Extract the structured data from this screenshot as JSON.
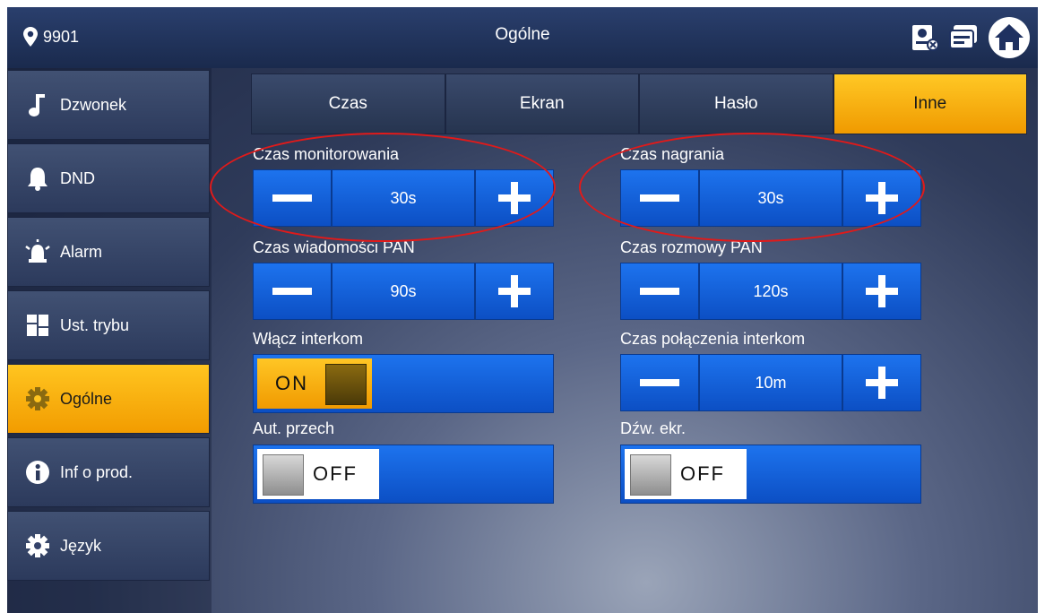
{
  "header": {
    "location": "9901",
    "title": "Ogólne",
    "icons": [
      "location-pin-icon",
      "monitor-camera-icon",
      "card-icon",
      "home-icon"
    ]
  },
  "sidebar": {
    "items": [
      {
        "label": "Dzwonek",
        "icon": "music-note-icon"
      },
      {
        "label": "DND",
        "icon": "bell-icon"
      },
      {
        "label": "Alarm",
        "icon": "alarm-siren-icon"
      },
      {
        "label": "Ust. trybu",
        "icon": "grid-mode-icon"
      },
      {
        "label": "Ogólne",
        "icon": "gear-icon",
        "active": true
      },
      {
        "label": "Inf o prod.",
        "icon": "info-icon"
      },
      {
        "label": "Język",
        "icon": "gear-icon"
      }
    ]
  },
  "tabs": [
    {
      "label": "Czas"
    },
    {
      "label": "Ekran"
    },
    {
      "label": "Hasło"
    },
    {
      "label": "Inne",
      "active": true
    }
  ],
  "settings": {
    "monitor_time": {
      "label": "Czas monitorowania",
      "value": "30s"
    },
    "record_time": {
      "label": "Czas nagrania",
      "value": "30s"
    },
    "vto_message_time": {
      "label": "Czas wiadomości PAN",
      "value": "90s"
    },
    "vto_talk_time": {
      "label": "Czas rozmowy PAN",
      "value": "120s"
    },
    "intercom_enable": {
      "label": "Włącz interkom",
      "state": "ON"
    },
    "intercom_call_time": {
      "label": "Czas połączenia interkom",
      "value": "10m"
    },
    "auto_snapshot": {
      "label": "Aut. przech",
      "state": "OFF"
    },
    "screen_sound": {
      "label": "Dźw. ekr.",
      "state": "OFF"
    }
  },
  "colors": {
    "accent": "#f7a80f",
    "control_blue": "#1565dc",
    "annotation_red": "#e01a1a"
  }
}
